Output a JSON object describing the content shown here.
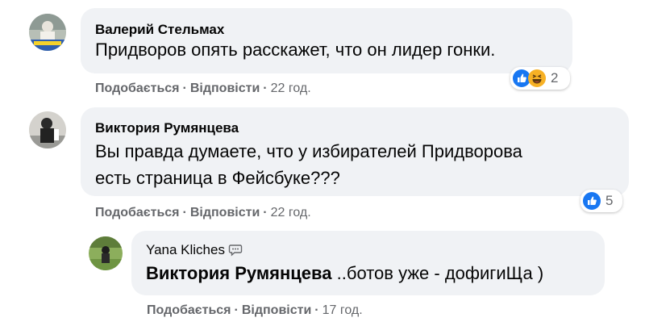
{
  "comments": [
    {
      "author": "Валерий Стельмах",
      "text_lines": [
        "Придворов опять расскажет, что он лидер гонки."
      ],
      "actions": {
        "like": "Подобається",
        "reply": "Відповісти",
        "time": "22 год."
      },
      "reactions": {
        "icons": [
          "like-icon",
          "haha-icon"
        ],
        "count": "2"
      }
    },
    {
      "author": "Виктория Румянцева",
      "text_lines": [
        "Вы правда думаете, что у избирателей Придворова",
        "есть страница в Фейсбуке???"
      ],
      "actions": {
        "like": "Подобається",
        "reply": "Відповісти",
        "time": "22 год."
      },
      "reactions": {
        "icons": [
          "like-icon"
        ],
        "count": "5"
      }
    }
  ],
  "reply": {
    "author": "Yana Kliches",
    "mention": "Виктория Румянцева",
    "text": "..ботов уже - дофигиЩа )",
    "actions": {
      "like": "Подобається",
      "reply": "Відповісти",
      "time": "17 год."
    }
  },
  "dot": "·",
  "colors": {
    "bubble": "#f0f2f5",
    "text": "#050505",
    "secondary": "#65676b",
    "like_blue": "#1877f2",
    "haha_yellow": "#f7b125"
  }
}
